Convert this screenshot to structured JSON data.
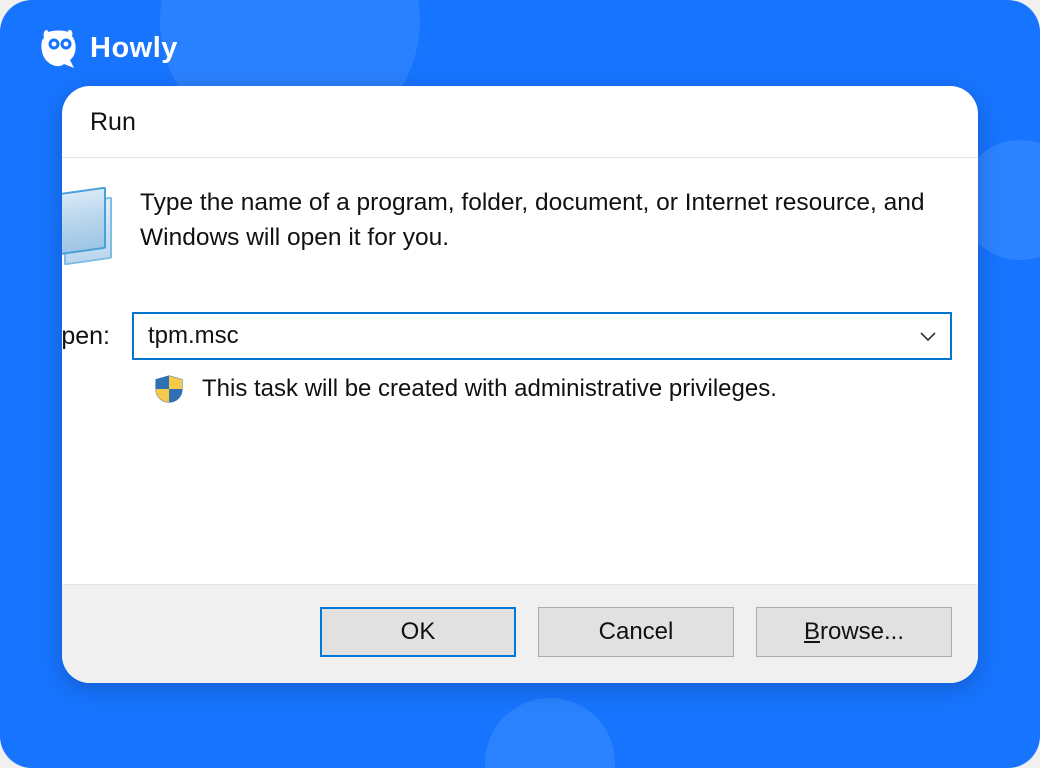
{
  "brand": {
    "name": "Howly"
  },
  "dialog": {
    "title": "Run",
    "message": "Type the name of a program, folder, document, or Internet resource, and Windows will open it for you.",
    "open_label": "pen:",
    "input_value": "tpm.msc",
    "admin_note": "This task will be created with administrative privileges.",
    "buttons": {
      "ok": "OK",
      "cancel": "Cancel",
      "browse": "Browse..."
    }
  }
}
